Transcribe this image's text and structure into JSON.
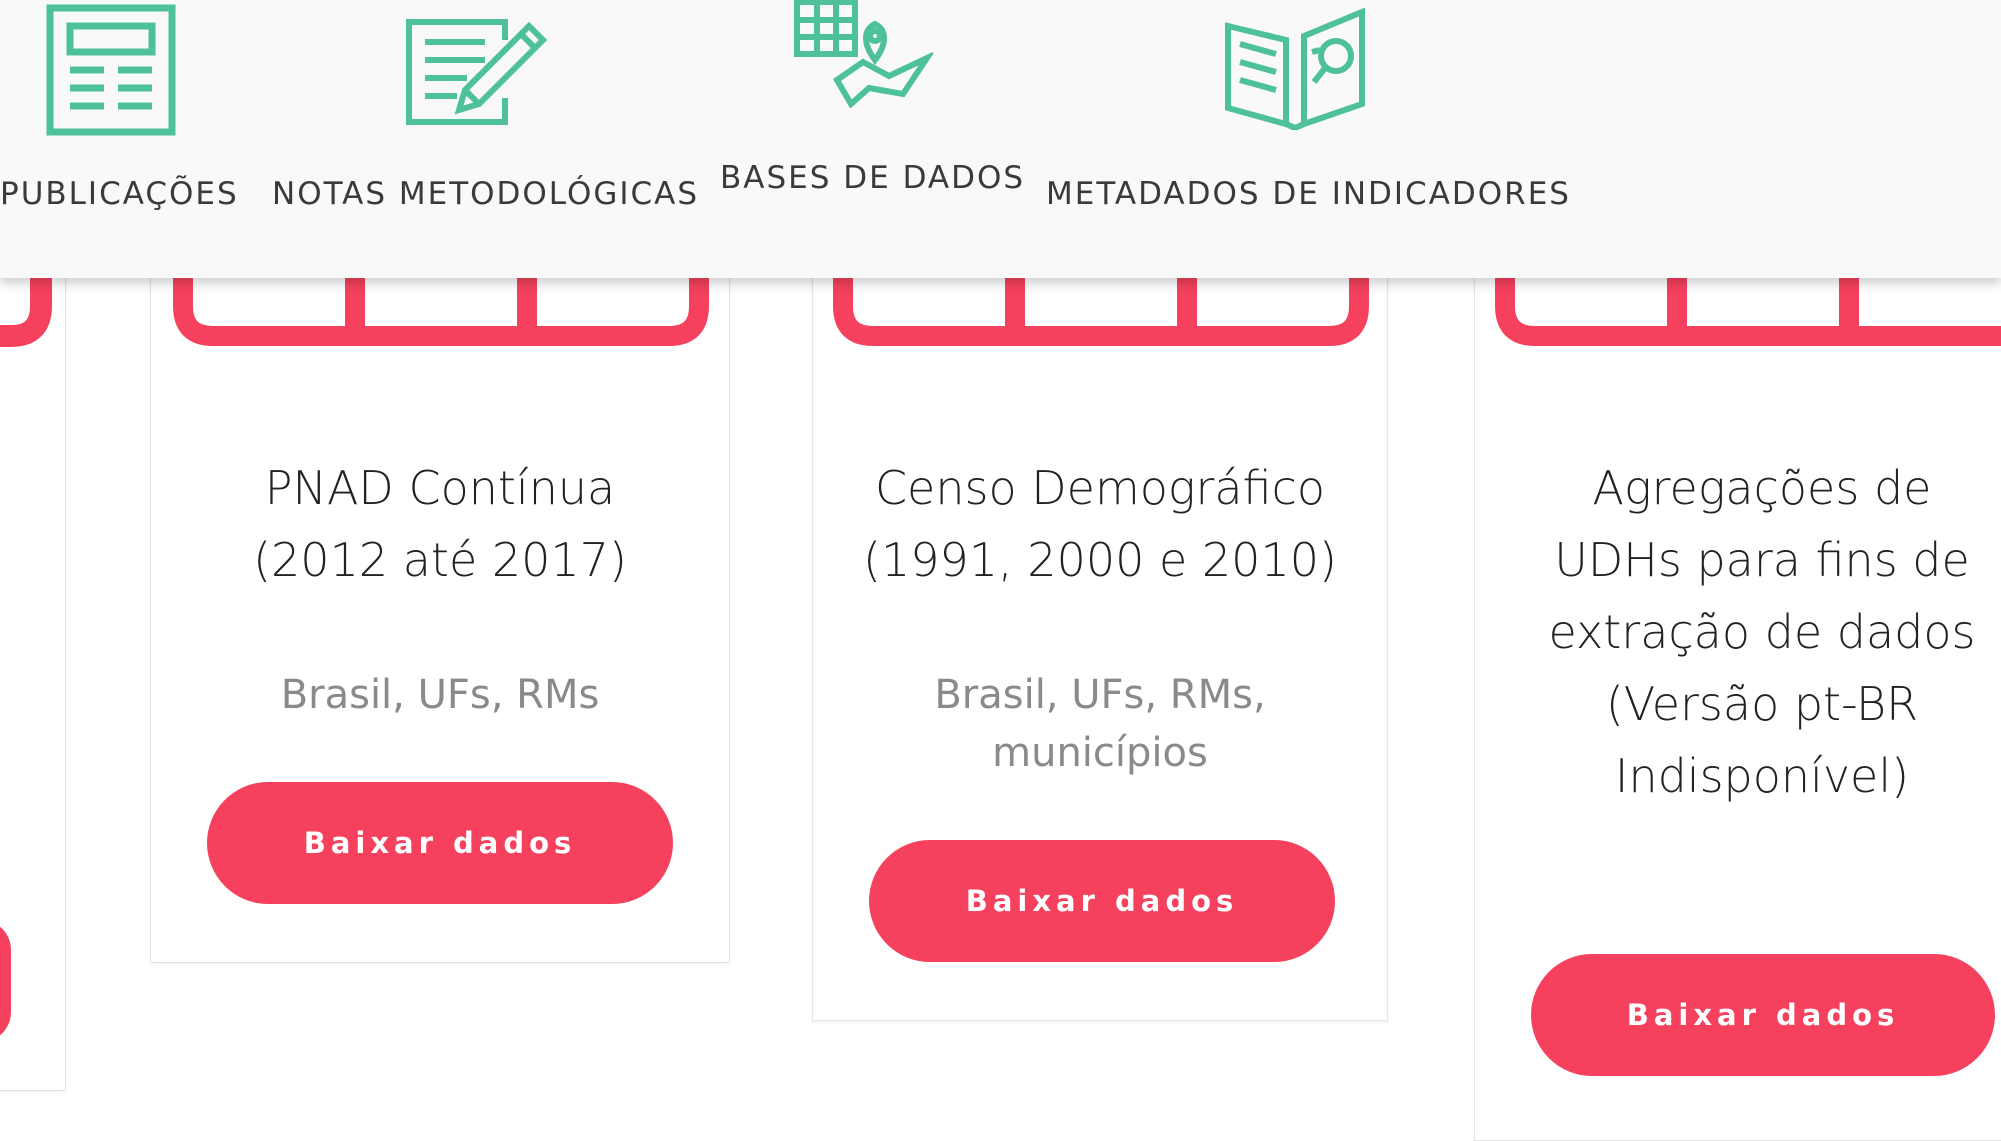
{
  "nav": {
    "items": [
      {
        "label": "PUBLICAÇÕES",
        "icon": "publication-icon"
      },
      {
        "label": "NOTAS METODOLÓGICAS",
        "icon": "notes-pencil-icon"
      },
      {
        "label": "BASES DE DADOS",
        "icon": "database-map-icon"
      },
      {
        "label": "METADADOS DE INDICADORES",
        "icon": "book-search-icon"
      }
    ]
  },
  "cards": [
    {
      "title_line1": "PNAD Contínua",
      "title_line2": "(2012 até 2017)",
      "subtitle_line1": "Brasil, UFs, RMs",
      "button": "Baixar dados"
    },
    {
      "title_line1": "Censo Demográfico",
      "title_line2": "(1991, 2000 e 2010)",
      "subtitle_line1": "Brasil, UFs, RMs,",
      "subtitle_line2": "municípios",
      "button": "Baixar dados"
    },
    {
      "title_line1": "Agregações de",
      "title_line2": "UDHs para fins de",
      "title_line3": "extração de dados",
      "title_line4": "(Versão pt-BR",
      "title_line5": "Indisponível)",
      "button": "Baixar dados"
    }
  ],
  "colors": {
    "accent_teal": "#4fc19a",
    "accent_red": "#f5415e",
    "nav_bg": "#f9f9f9"
  }
}
